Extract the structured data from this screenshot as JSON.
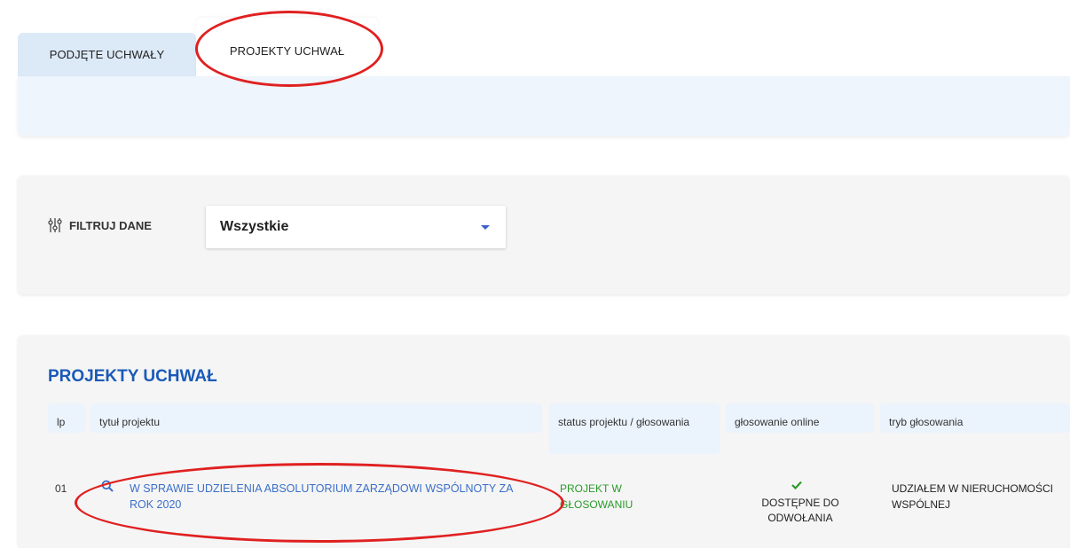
{
  "tabs": [
    {
      "label": "PODJĘTE UCHWAŁY",
      "active": false
    },
    {
      "label": "PROJEKTY UCHWAŁ",
      "active": true
    }
  ],
  "filter": {
    "label": "FILTRUJ DANE",
    "selected": "Wszystkie"
  },
  "projects": {
    "title": "PROJEKTY UCHWAŁ",
    "columns": {
      "lp": "lp",
      "title": "tytuł projektu",
      "status": "status projektu / głosowania",
      "online": "głosowanie online",
      "mode": "tryb głosowania"
    },
    "rows": [
      {
        "lp": "01",
        "title": "W SPRAWIE UDZIELENIA ABSOLUTORIUM ZARZĄDOWI WSPÓLNOTY ZA ROK 2020",
        "status": "PROJEKT W GŁOSOWANIU",
        "online": "DOSTĘPNE DO ODWOŁANIA",
        "mode": "UDZIAŁEM W NIERUCHOMOŚCI WSPÓLNEJ"
      }
    ]
  },
  "colors": {
    "accent_blue": "#1a5ab8",
    "link_blue": "#3b6fc8",
    "status_green": "#2a9a2a",
    "annotation_red": "#e02020"
  }
}
